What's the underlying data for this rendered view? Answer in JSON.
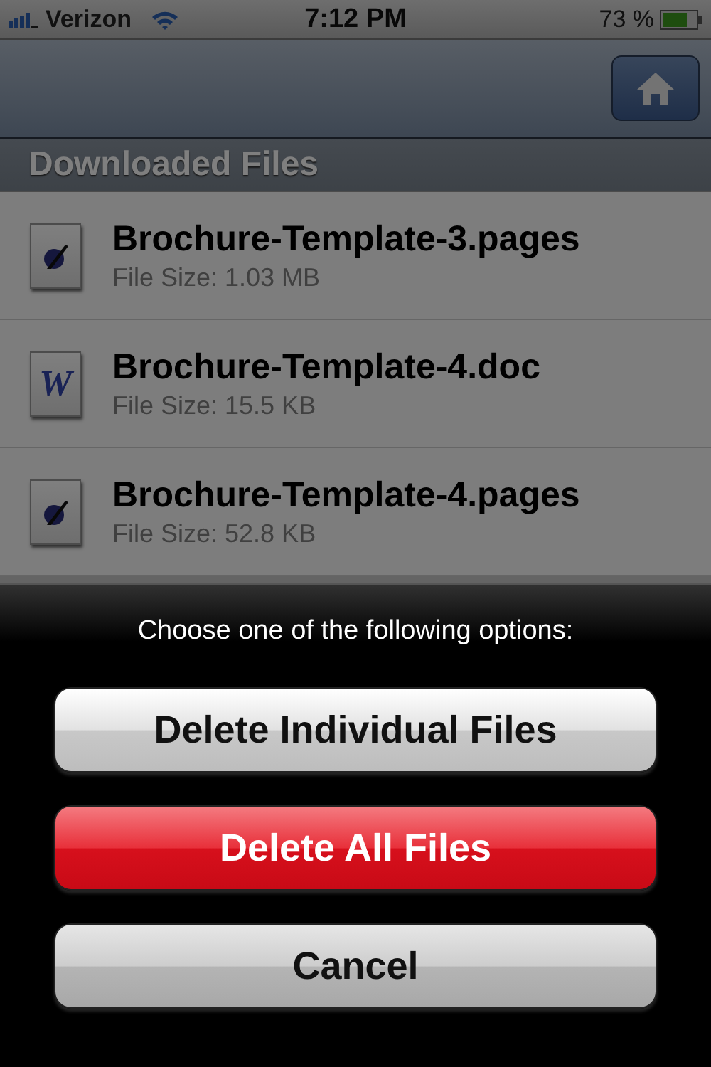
{
  "status_bar": {
    "carrier": "Verizon",
    "time": "7:12 PM",
    "battery": "73 %"
  },
  "section_header": "Downloaded Files",
  "files": [
    {
      "kind": "pages",
      "name": "Brochure-Template-3.pages",
      "size": "File Size: 1.03 MB"
    },
    {
      "kind": "doc",
      "icon_glyph": "W",
      "name": "Brochure-Template-4.doc",
      "size": "File Size: 15.5 KB"
    },
    {
      "kind": "pages",
      "name": "Brochure-Template-4.pages",
      "size": "File Size: 52.8 KB"
    }
  ],
  "action_sheet": {
    "title": "Choose one of the following options:",
    "buttons": [
      {
        "kind": "normal",
        "label": "Delete Individual Files"
      },
      {
        "kind": "destructive",
        "label": "Delete All Files"
      },
      {
        "kind": "cancel",
        "label": "Cancel"
      }
    ]
  }
}
